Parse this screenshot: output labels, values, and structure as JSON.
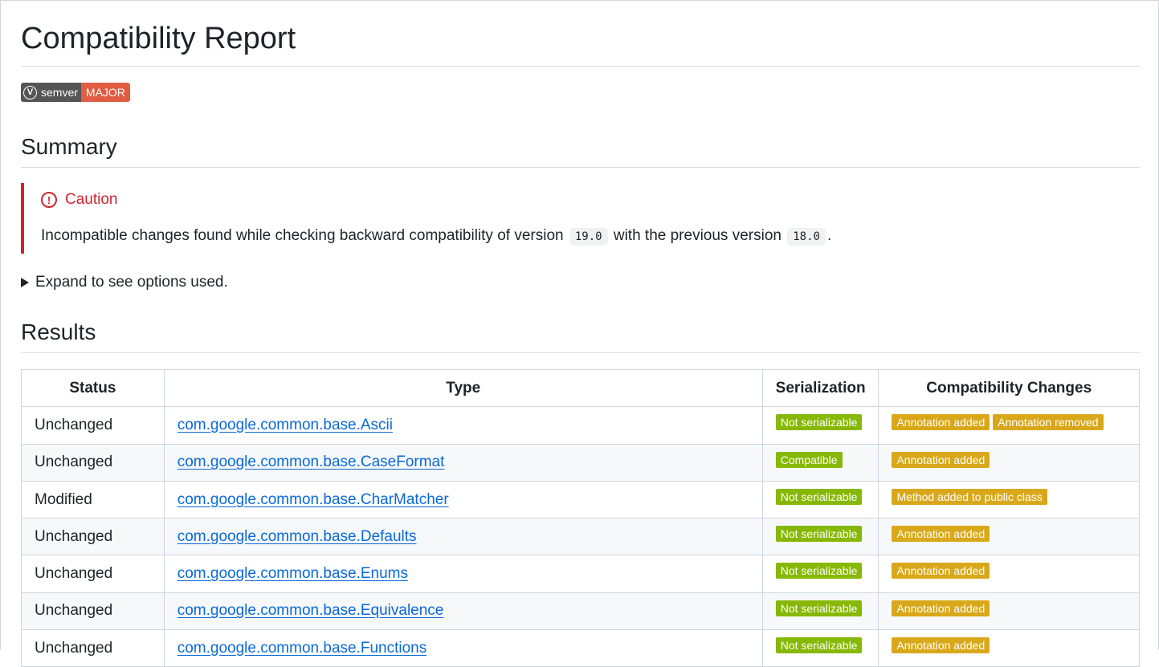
{
  "title": "Compatibility Report",
  "badge": {
    "icon": "v-logo-icon",
    "label": "semver",
    "value": "MAJOR",
    "label_color": "#555555",
    "value_color": "#e05d44"
  },
  "summary": {
    "heading": "Summary",
    "callout": {
      "title": "Caution",
      "icon": "caution-circle-icon",
      "text_before": "Incompatible changes found while checking backward compatibility of version",
      "version": "19.0",
      "text_middle": "with the previous version",
      "previous_version": "18.0",
      "text_after": ".",
      "color": "#cf222e"
    },
    "details_label": "Expand to see options used."
  },
  "results": {
    "heading": "Results",
    "columns": [
      "Status",
      "Type",
      "Serialization",
      "Compatibility Changes"
    ],
    "rows": [
      {
        "status": "Unchanged",
        "type": "com.google.common.base.Ascii",
        "serialization": "Not serializable",
        "changes": [
          "Annotation added",
          "Annotation removed"
        ]
      },
      {
        "status": "Unchanged",
        "type": "com.google.common.base.CaseFormat",
        "serialization": "Compatible",
        "changes": [
          "Annotation added"
        ]
      },
      {
        "status": "Modified",
        "type": "com.google.common.base.CharMatcher",
        "serialization": "Not serializable",
        "changes": [
          "Method added to public class"
        ]
      },
      {
        "status": "Unchanged",
        "type": "com.google.common.base.Defaults",
        "serialization": "Not serializable",
        "changes": [
          "Annotation added"
        ]
      },
      {
        "status": "Unchanged",
        "type": "com.google.common.base.Enums",
        "serialization": "Not serializable",
        "changes": [
          "Annotation added"
        ]
      },
      {
        "status": "Unchanged",
        "type": "com.google.common.base.Equivalence",
        "serialization": "Not serializable",
        "changes": [
          "Annotation added"
        ]
      },
      {
        "status": "Unchanged",
        "type": "com.google.common.base.Functions",
        "serialization": "Not serializable",
        "changes": [
          "Annotation added"
        ]
      }
    ],
    "colors": {
      "serialization_tag": "#86b805",
      "change_tag": "#d9a81a",
      "link": "#0969da"
    }
  }
}
